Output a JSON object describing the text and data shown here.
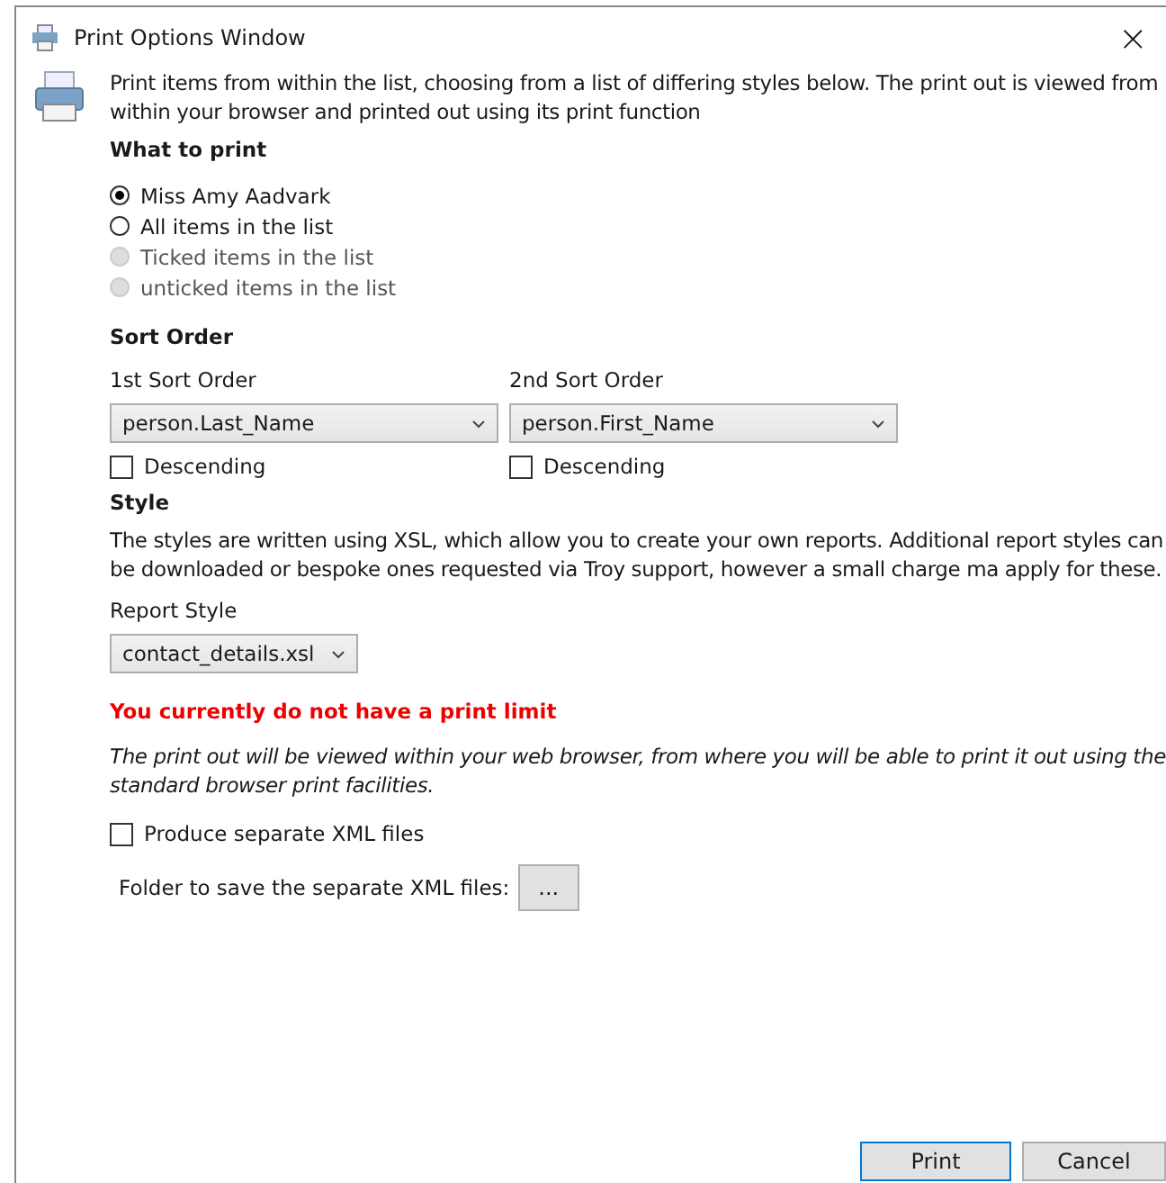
{
  "window": {
    "title": "Print Options Window",
    "close": "×"
  },
  "intro": "Print items from within the list, choosing from a list of differing styles below. The print out is viewed from within your browser and printed out using its print function",
  "what_to_print": {
    "heading": "What to print",
    "options": [
      {
        "label": "Miss Amy Aadvark",
        "selected": true,
        "disabled": false
      },
      {
        "label": "All items in the list",
        "selected": false,
        "disabled": false
      },
      {
        "label": "Ticked items in the list",
        "selected": false,
        "disabled": true
      },
      {
        "label": "unticked items in the list",
        "selected": false,
        "disabled": true
      }
    ]
  },
  "sort_order": {
    "heading": "Sort Order",
    "columns": [
      {
        "label": "1st Sort Order",
        "value": "person.Last_Name",
        "descending_label": "Descending",
        "descending": false
      },
      {
        "label": "2nd Sort Order",
        "value": "person.First_Name",
        "descending_label": "Descending",
        "descending": false
      }
    ]
  },
  "style": {
    "heading": "Style",
    "description": "The styles are written using XSL, which allow you to create your own reports. Additional report styles can be downloaded or bespoke ones requested via Troy support, however a small charge ma apply for these.",
    "report_style_label": "Report Style",
    "report_style": "contact_details.xsl"
  },
  "print_limit": "You currently do not have a print limit",
  "note": "The print out will be viewed within your web browser, from where you will be able to print it out using the standard browser print facilities.",
  "separate_xml": {
    "label": "Produce separate XML files",
    "checked": false
  },
  "folder": {
    "label": "Folder to save the separate XML files:",
    "button": "..."
  },
  "buttons": [
    {
      "label": "Print",
      "default": true
    },
    {
      "label": "Cancel",
      "default": false
    }
  ]
}
